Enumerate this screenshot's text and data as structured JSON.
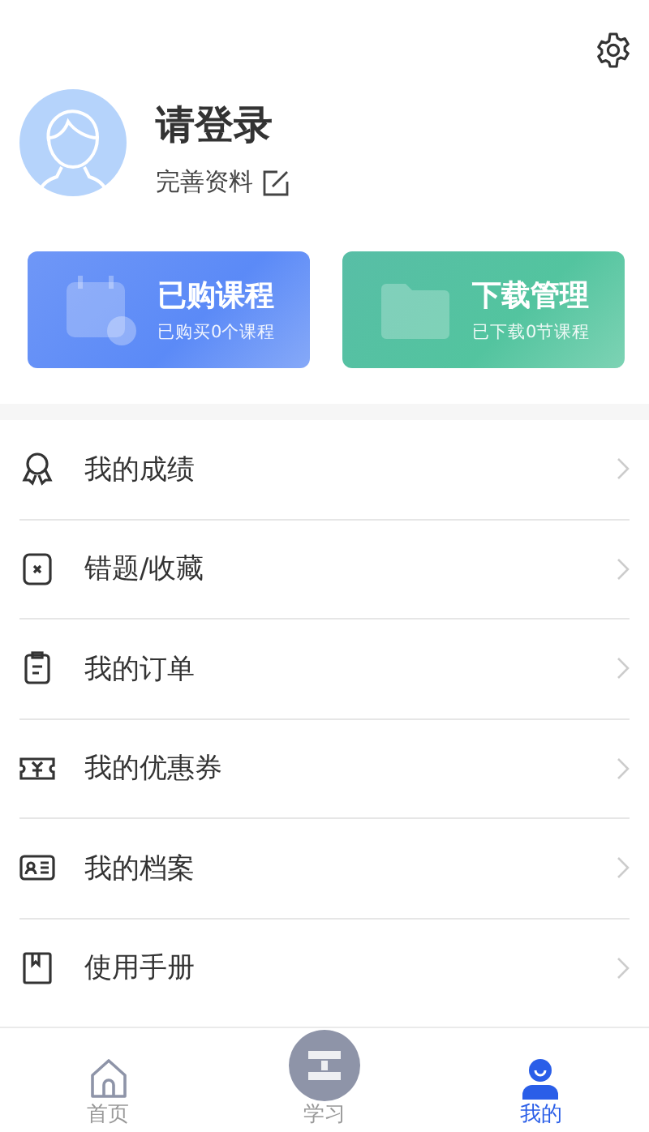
{
  "profile": {
    "name": "请登录",
    "edit_label": "完善资料"
  },
  "cards": [
    {
      "title": "已购课程",
      "subtitle": "已购买0个课程"
    },
    {
      "title": "下载管理",
      "subtitle": "已下载0节课程"
    }
  ],
  "menu": [
    {
      "label": "我的成绩"
    },
    {
      "label": "错题/收藏"
    },
    {
      "label": "我的订单"
    },
    {
      "label": "我的优惠券"
    },
    {
      "label": "我的档案"
    },
    {
      "label": "使用手册"
    }
  ],
  "tab_bar": [
    {
      "label": "首页",
      "selected": false
    },
    {
      "label": "学习",
      "selected": false
    },
    {
      "label": "我的",
      "selected": true
    }
  ]
}
